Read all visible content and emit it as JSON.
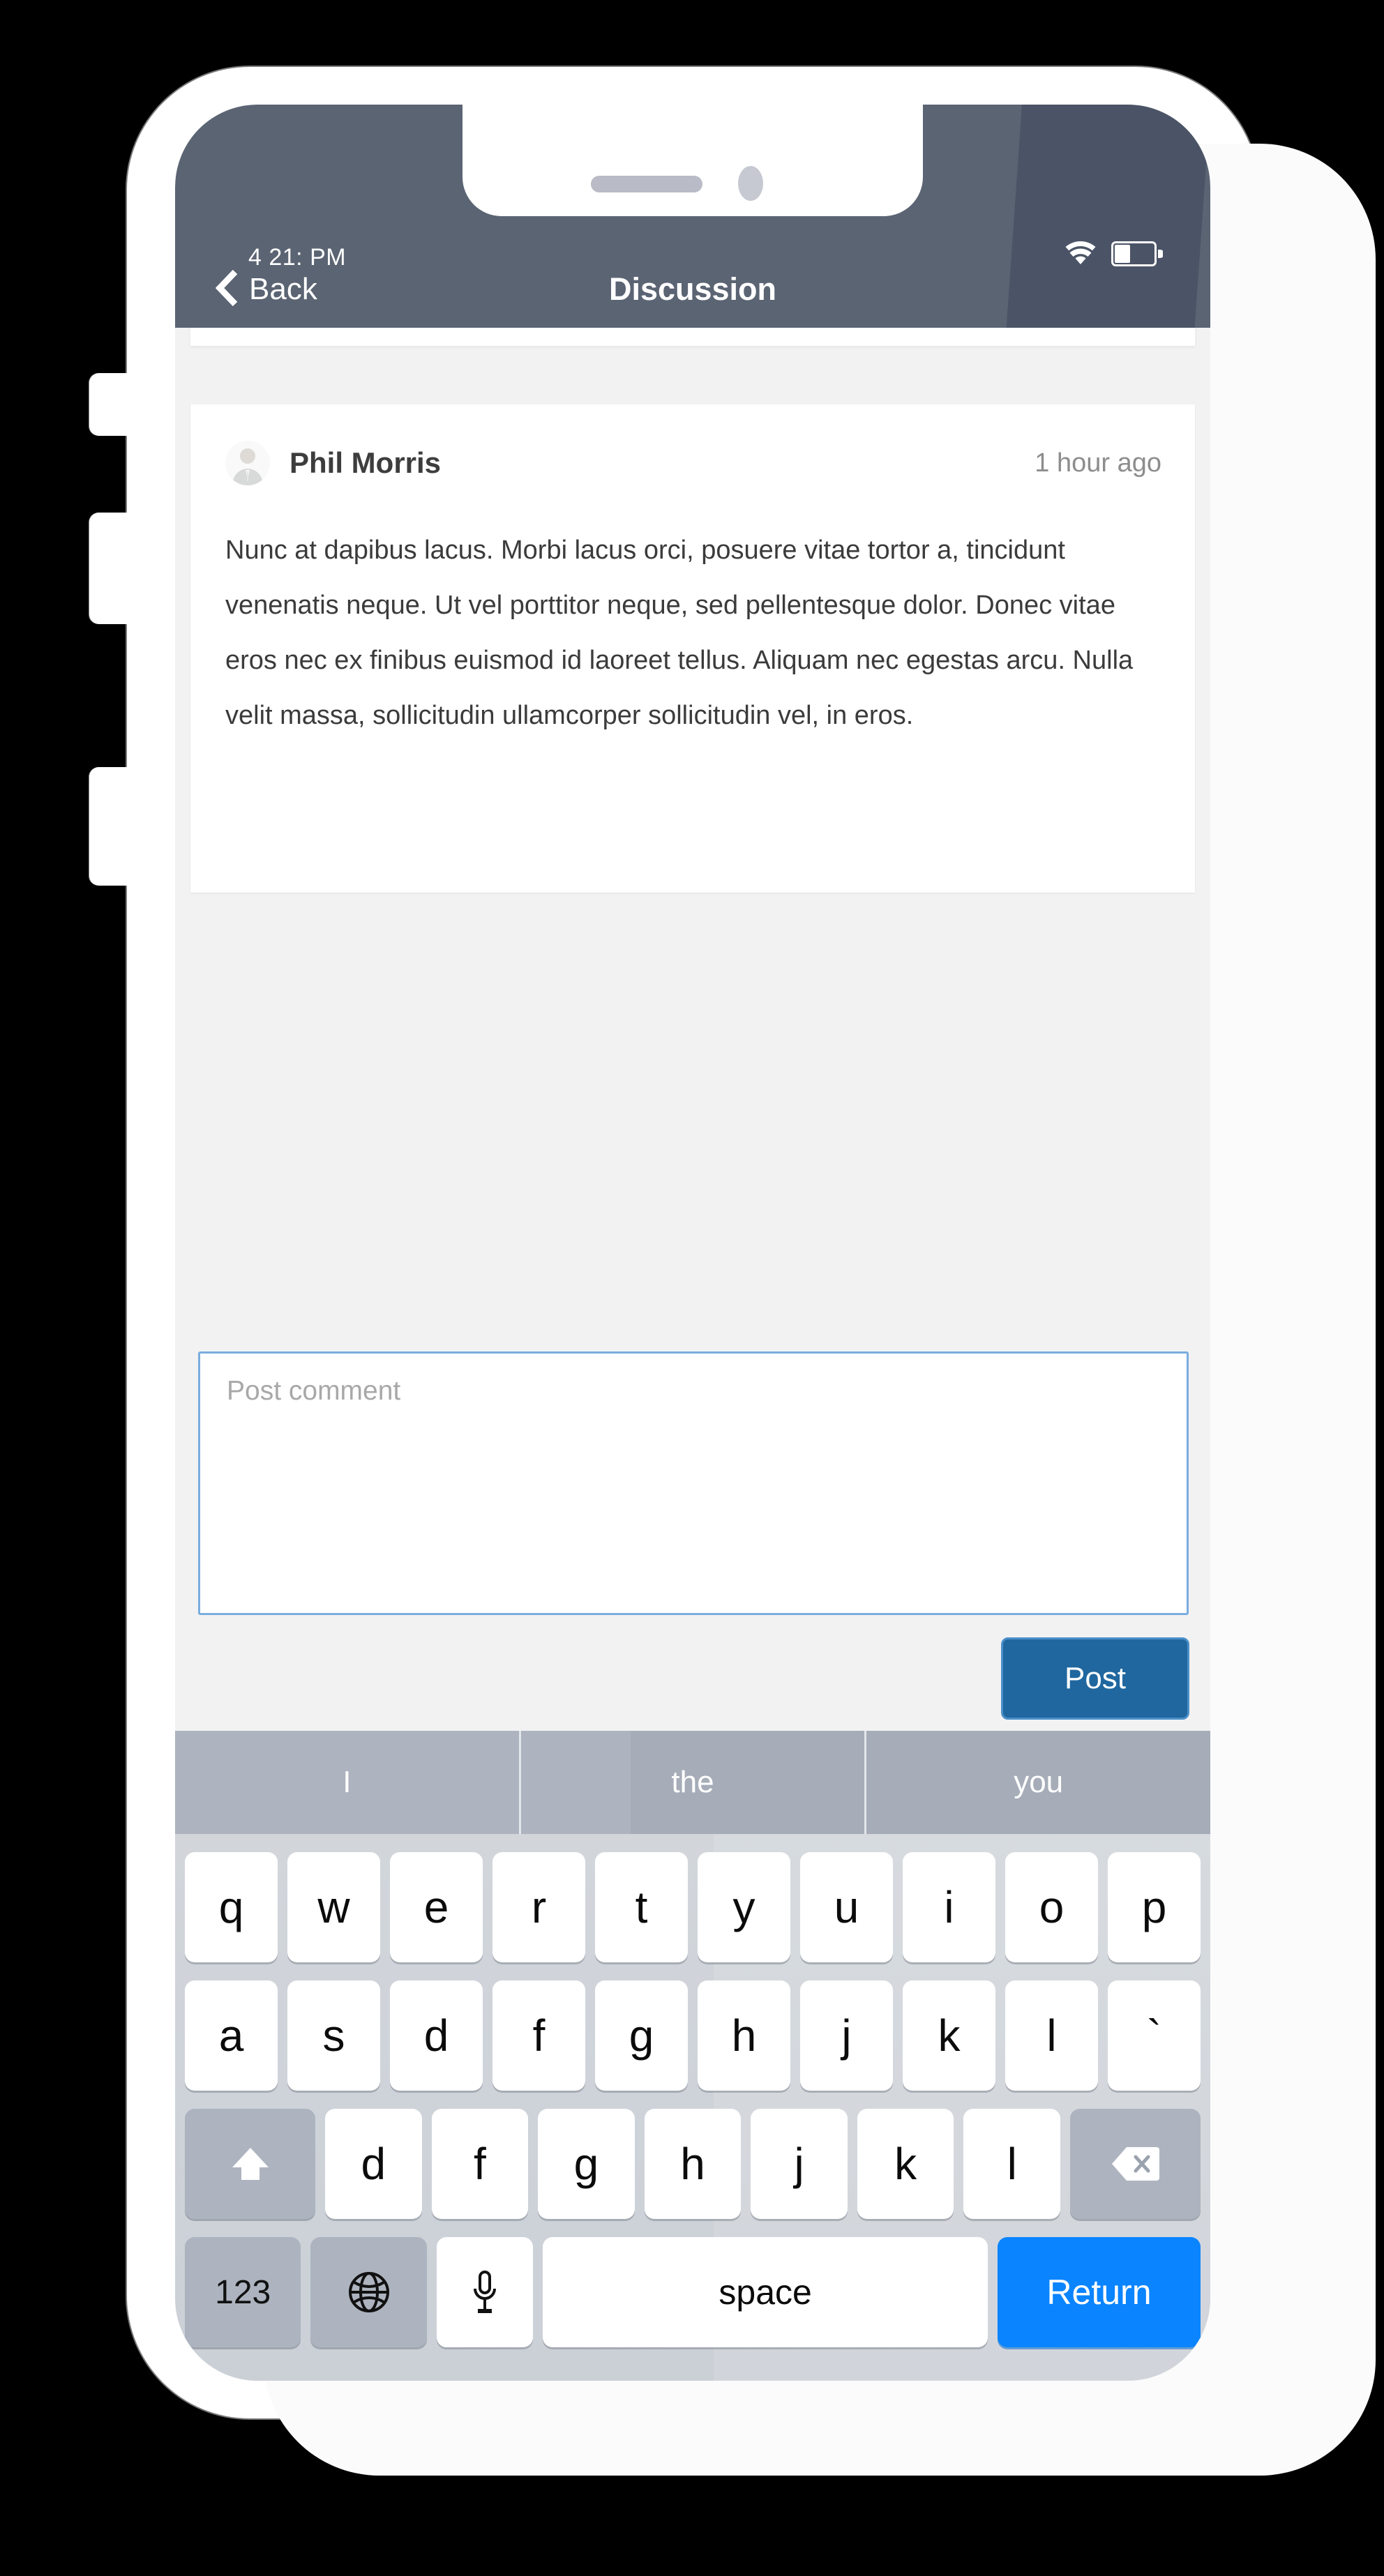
{
  "device": {
    "side_buttons": [
      "silent-switch",
      "volume-up",
      "volume-down"
    ]
  },
  "status_bar": {
    "time": "4 21: PM",
    "wifi_icon": "wifi-icon",
    "battery_icon": "battery-icon",
    "battery_level_percent": 35
  },
  "nav_bar": {
    "back_label": "Back",
    "back_icon": "chevron-left-icon",
    "title": "Discussion",
    "background_color": "#5b6473"
  },
  "comment": {
    "author": "Phil Morris",
    "timestamp": "1 hour ago",
    "avatar_icon": "user-avatar-photo",
    "body": "Nunc at dapibus lacus. Morbi lacus orci, posuere vitae tortor a, tincidunt venenatis neque. Ut vel porttitor neque, sed pellentesque dolor. Donec vitae eros nec ex finibus euismod id laoreet tellus. Aliquam nec egestas arcu. Nulla velit massa, sollicitudin ullamcorper sollicitudin vel, in eros."
  },
  "composer": {
    "placeholder": "Post comment",
    "value": "",
    "post_label": "Post",
    "post_color": "#20679f",
    "focus_border_color": "#7aadde"
  },
  "keyboard": {
    "suggestions": [
      "I",
      "the",
      "you"
    ],
    "row1": [
      "q",
      "w",
      "e",
      "r",
      "t",
      "y",
      "u",
      "i",
      "o",
      "p"
    ],
    "row2": [
      "a",
      "s",
      "d",
      "f",
      "g",
      "h",
      "j",
      "k",
      "l",
      "`"
    ],
    "row3_letters": [
      "d",
      "f",
      "g",
      "h",
      "j",
      "k",
      "l"
    ],
    "shift_icon": "shift-arrow-icon",
    "backspace_icon": "backspace-icon",
    "numbers_label": "123",
    "globe_icon": "globe-icon",
    "mic_icon": "microphone-icon",
    "space_label": "space",
    "return_label": "Return",
    "return_color": "#0a84ff"
  }
}
